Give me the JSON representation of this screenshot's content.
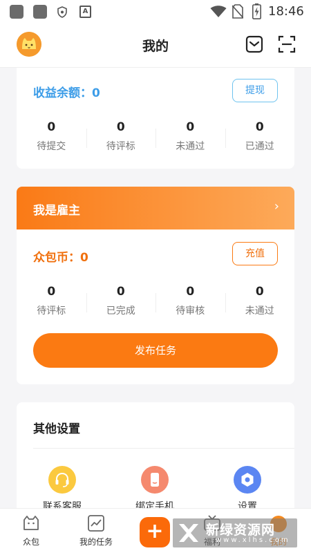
{
  "status_bar": {
    "time": "18:46",
    "input_badge": "A"
  },
  "header": {
    "title": "我的"
  },
  "earnings": {
    "balance_label": "收益余额：0",
    "withdraw_label": "提现",
    "stats": [
      {
        "value": "0",
        "label": "待提交"
      },
      {
        "value": "0",
        "label": "待评标"
      },
      {
        "value": "0",
        "label": "未通过"
      },
      {
        "value": "0",
        "label": "已通过"
      }
    ]
  },
  "employer": {
    "title": "我是雇主",
    "chevron": "›",
    "coins_label": "众包币：0",
    "recharge_label": "充值",
    "stats": [
      {
        "value": "0",
        "label": "待评标"
      },
      {
        "value": "0",
        "label": "已完成"
      },
      {
        "value": "0",
        "label": "待审核"
      },
      {
        "value": "0",
        "label": "未通过"
      }
    ],
    "publish_label": "发布任务"
  },
  "other_settings": {
    "title": "其他设置",
    "items": [
      {
        "label": "联系客服",
        "icon": "headset-icon"
      },
      {
        "label": "绑定手机",
        "icon": "phone-icon"
      },
      {
        "label": "设置",
        "icon": "settings-hexagon-icon"
      }
    ]
  },
  "bottom_nav": {
    "items": [
      {
        "label": "众包",
        "icon": "cat-icon"
      },
      {
        "label": "我的任务",
        "icon": "chart-icon"
      },
      {
        "label": "+",
        "icon": "plus-icon"
      },
      {
        "label": "福利",
        "icon": "tv-icon"
      },
      {
        "label": "我的",
        "icon": "mine-icon"
      }
    ]
  },
  "watermark": {
    "main": "新绿资源网",
    "sub": "www.xlhs.com"
  },
  "colors": {
    "accent_orange": "#fb7a12",
    "balance_blue": "#3d9de8",
    "withdraw_border": "#6ec3ef"
  }
}
